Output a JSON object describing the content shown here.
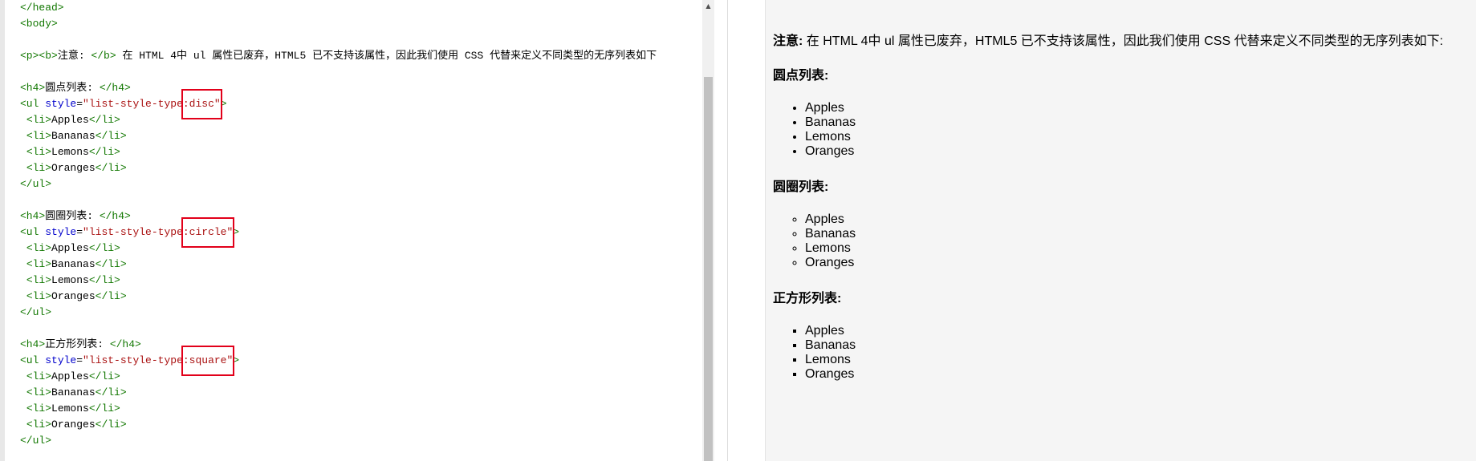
{
  "editor": {
    "lines": [
      [
        {
          "c": "tag",
          "t": "</head>"
        }
      ],
      [
        {
          "c": "tag",
          "t": "<body>"
        }
      ],
      [],
      [
        {
          "c": "tag",
          "t": "<p><b>"
        },
        {
          "c": "txt",
          "t": "注意: "
        },
        {
          "c": "tag",
          "t": "</b>"
        },
        {
          "c": "txt",
          "t": " 在 HTML 4中 ul 属性已废弃，HTML5 已不支持该属性，因此我们使用 CSS 代替来定义不同类型的无序列表如下"
        }
      ],
      [],
      [
        {
          "c": "tag",
          "t": "<h4>"
        },
        {
          "c": "txt",
          "t": "圆点列表: "
        },
        {
          "c": "tag",
          "t": "</h4>"
        }
      ],
      [
        {
          "c": "tag",
          "t": "<ul "
        },
        {
          "c": "attr",
          "t": "style"
        },
        {
          "c": "txt",
          "t": "="
        },
        {
          "c": "val",
          "t": "\"list-style-type:disc\""
        },
        {
          "c": "tag",
          "t": ">"
        }
      ],
      [
        {
          "c": "txt",
          "t": " "
        },
        {
          "c": "tag",
          "t": "<li>"
        },
        {
          "c": "txt",
          "t": "Apples"
        },
        {
          "c": "tag",
          "t": "</li>"
        }
      ],
      [
        {
          "c": "txt",
          "t": " "
        },
        {
          "c": "tag",
          "t": "<li>"
        },
        {
          "c": "txt",
          "t": "Bananas"
        },
        {
          "c": "tag",
          "t": "</li>"
        }
      ],
      [
        {
          "c": "txt",
          "t": " "
        },
        {
          "c": "tag",
          "t": "<li>"
        },
        {
          "c": "txt",
          "t": "Lemons"
        },
        {
          "c": "tag",
          "t": "</li>"
        }
      ],
      [
        {
          "c": "txt",
          "t": " "
        },
        {
          "c": "tag",
          "t": "<li>"
        },
        {
          "c": "txt",
          "t": "Oranges"
        },
        {
          "c": "tag",
          "t": "</li>"
        }
      ],
      [
        {
          "c": "tag",
          "t": "</ul>"
        }
      ],
      [],
      [
        {
          "c": "tag",
          "t": "<h4>"
        },
        {
          "c": "txt",
          "t": "圆圈列表: "
        },
        {
          "c": "tag",
          "t": "</h4>"
        }
      ],
      [
        {
          "c": "tag",
          "t": "<ul "
        },
        {
          "c": "attr",
          "t": "style"
        },
        {
          "c": "txt",
          "t": "="
        },
        {
          "c": "val",
          "t": "\"list-style-type:circle\""
        },
        {
          "c": "tag",
          "t": ">"
        }
      ],
      [
        {
          "c": "txt",
          "t": " "
        },
        {
          "c": "tag",
          "t": "<li>"
        },
        {
          "c": "txt",
          "t": "Apples"
        },
        {
          "c": "tag",
          "t": "</li>"
        }
      ],
      [
        {
          "c": "txt",
          "t": " "
        },
        {
          "c": "tag",
          "t": "<li>"
        },
        {
          "c": "txt",
          "t": "Bananas"
        },
        {
          "c": "tag",
          "t": "</li>"
        }
      ],
      [
        {
          "c": "txt",
          "t": " "
        },
        {
          "c": "tag",
          "t": "<li>"
        },
        {
          "c": "txt",
          "t": "Lemons"
        },
        {
          "c": "tag",
          "t": "</li>"
        }
      ],
      [
        {
          "c": "txt",
          "t": " "
        },
        {
          "c": "tag",
          "t": "<li>"
        },
        {
          "c": "txt",
          "t": "Oranges"
        },
        {
          "c": "tag",
          "t": "</li>"
        }
      ],
      [
        {
          "c": "tag",
          "t": "</ul>"
        }
      ],
      [],
      [
        {
          "c": "tag",
          "t": "<h4>"
        },
        {
          "c": "txt",
          "t": "正方形列表: "
        },
        {
          "c": "tag",
          "t": "</h4>"
        }
      ],
      [
        {
          "c": "tag",
          "t": "<ul "
        },
        {
          "c": "attr",
          "t": "style"
        },
        {
          "c": "txt",
          "t": "="
        },
        {
          "c": "val",
          "t": "\"list-style-type:square\""
        },
        {
          "c": "tag",
          "t": ">"
        }
      ],
      [
        {
          "c": "txt",
          "t": " "
        },
        {
          "c": "tag",
          "t": "<li>"
        },
        {
          "c": "txt",
          "t": "Apples"
        },
        {
          "c": "tag",
          "t": "</li>"
        }
      ],
      [
        {
          "c": "txt",
          "t": " "
        },
        {
          "c": "tag",
          "t": "<li>"
        },
        {
          "c": "txt",
          "t": "Bananas"
        },
        {
          "c": "tag",
          "t": "</li>"
        }
      ],
      [
        {
          "c": "txt",
          "t": " "
        },
        {
          "c": "tag",
          "t": "<li>"
        },
        {
          "c": "txt",
          "t": "Lemons"
        },
        {
          "c": "tag",
          "t": "</li>"
        }
      ],
      [
        {
          "c": "txt",
          "t": " "
        },
        {
          "c": "tag",
          "t": "<li>"
        },
        {
          "c": "txt",
          "t": "Oranges"
        },
        {
          "c": "tag",
          "t": "</li>"
        }
      ],
      [
        {
          "c": "tag",
          "t": "</ul>"
        }
      ]
    ],
    "highlights": [
      {
        "line": 6,
        "text": ":disc\""
      },
      {
        "line": 14,
        "text": ":circle\""
      },
      {
        "line": 22,
        "text": ":square\""
      }
    ],
    "colors": {
      "tag": "#117700",
      "attr": "#0000cc",
      "value": "#aa1111",
      "highlight": "#e2001a"
    }
  },
  "scrollbar": {
    "up_icon": "scroll-up-arrow-icon"
  },
  "preview": {
    "note_label": "注意:",
    "note_text": " 在 HTML 4中 ul 属性已废弃，HTML5 已不支持该属性，因此我们使用 CSS 代替来定义不同类型的无序列表如下:",
    "sections": [
      {
        "heading": "圆点列表:",
        "style": "disc",
        "items": [
          "Apples",
          "Bananas",
          "Lemons",
          "Oranges"
        ]
      },
      {
        "heading": "圆圈列表:",
        "style": "circle",
        "items": [
          "Apples",
          "Bananas",
          "Lemons",
          "Oranges"
        ]
      },
      {
        "heading": "正方形列表:",
        "style": "square",
        "items": [
          "Apples",
          "Bananas",
          "Lemons",
          "Oranges"
        ]
      }
    ]
  }
}
